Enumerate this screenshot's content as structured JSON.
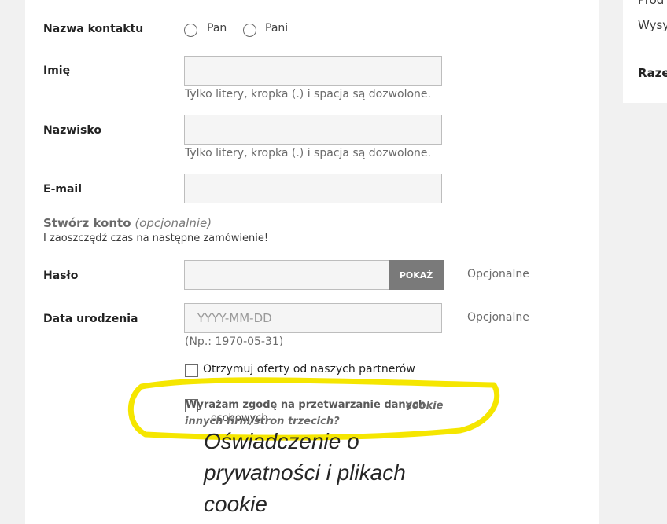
{
  "side": {
    "line1": "Prod",
    "line2": "Wysy",
    "line3": "Raze"
  },
  "form": {
    "title_label": "Nazwa kontaktu",
    "title_options": [
      "Pan",
      "Pani"
    ],
    "first_name_label": "Imię",
    "first_name_hint": "Tylko litery, kropka (.) i spacja są dozwolone.",
    "last_name_label": "Nazwisko",
    "last_name_hint": "Tylko litery, kropka (.) i spacja są dozwolone.",
    "email_label": "E-mail",
    "create_account_title": "Stwórz konto",
    "create_account_optional": "(opcjonalnie)",
    "create_account_subtitle": "I zaoszczędź czas na następne zamówienie!",
    "password_label": "Hasło",
    "password_show_button": "POKAŻ",
    "password_optional": "Opcjonalne",
    "birthdate_label": "Data urodzenia",
    "birthdate_placeholder": "YYYY-MM-DD",
    "birthdate_optional": "Opcjonalne",
    "birthdate_hint": "(Np.: 1970-05-31)",
    "partners_offer_label": "Otrzymuj oferty od naszych partnerów",
    "data_processing_label_line1": "Wyrażam zgodę na przetwarzanie danych",
    "data_processing_label_line2": "osobowych",
    "cookie_question_line1": "cookie",
    "cookie_question_line2": "innych firm/stron trzecich?",
    "privacy_title_line1": "Oświadczenie o",
    "privacy_title_line2": "prywatności i plikach",
    "privacy_title_line3": "cookie"
  },
  "colors": {
    "highlight": "#f5e600",
    "button": "#7a7a7a"
  }
}
